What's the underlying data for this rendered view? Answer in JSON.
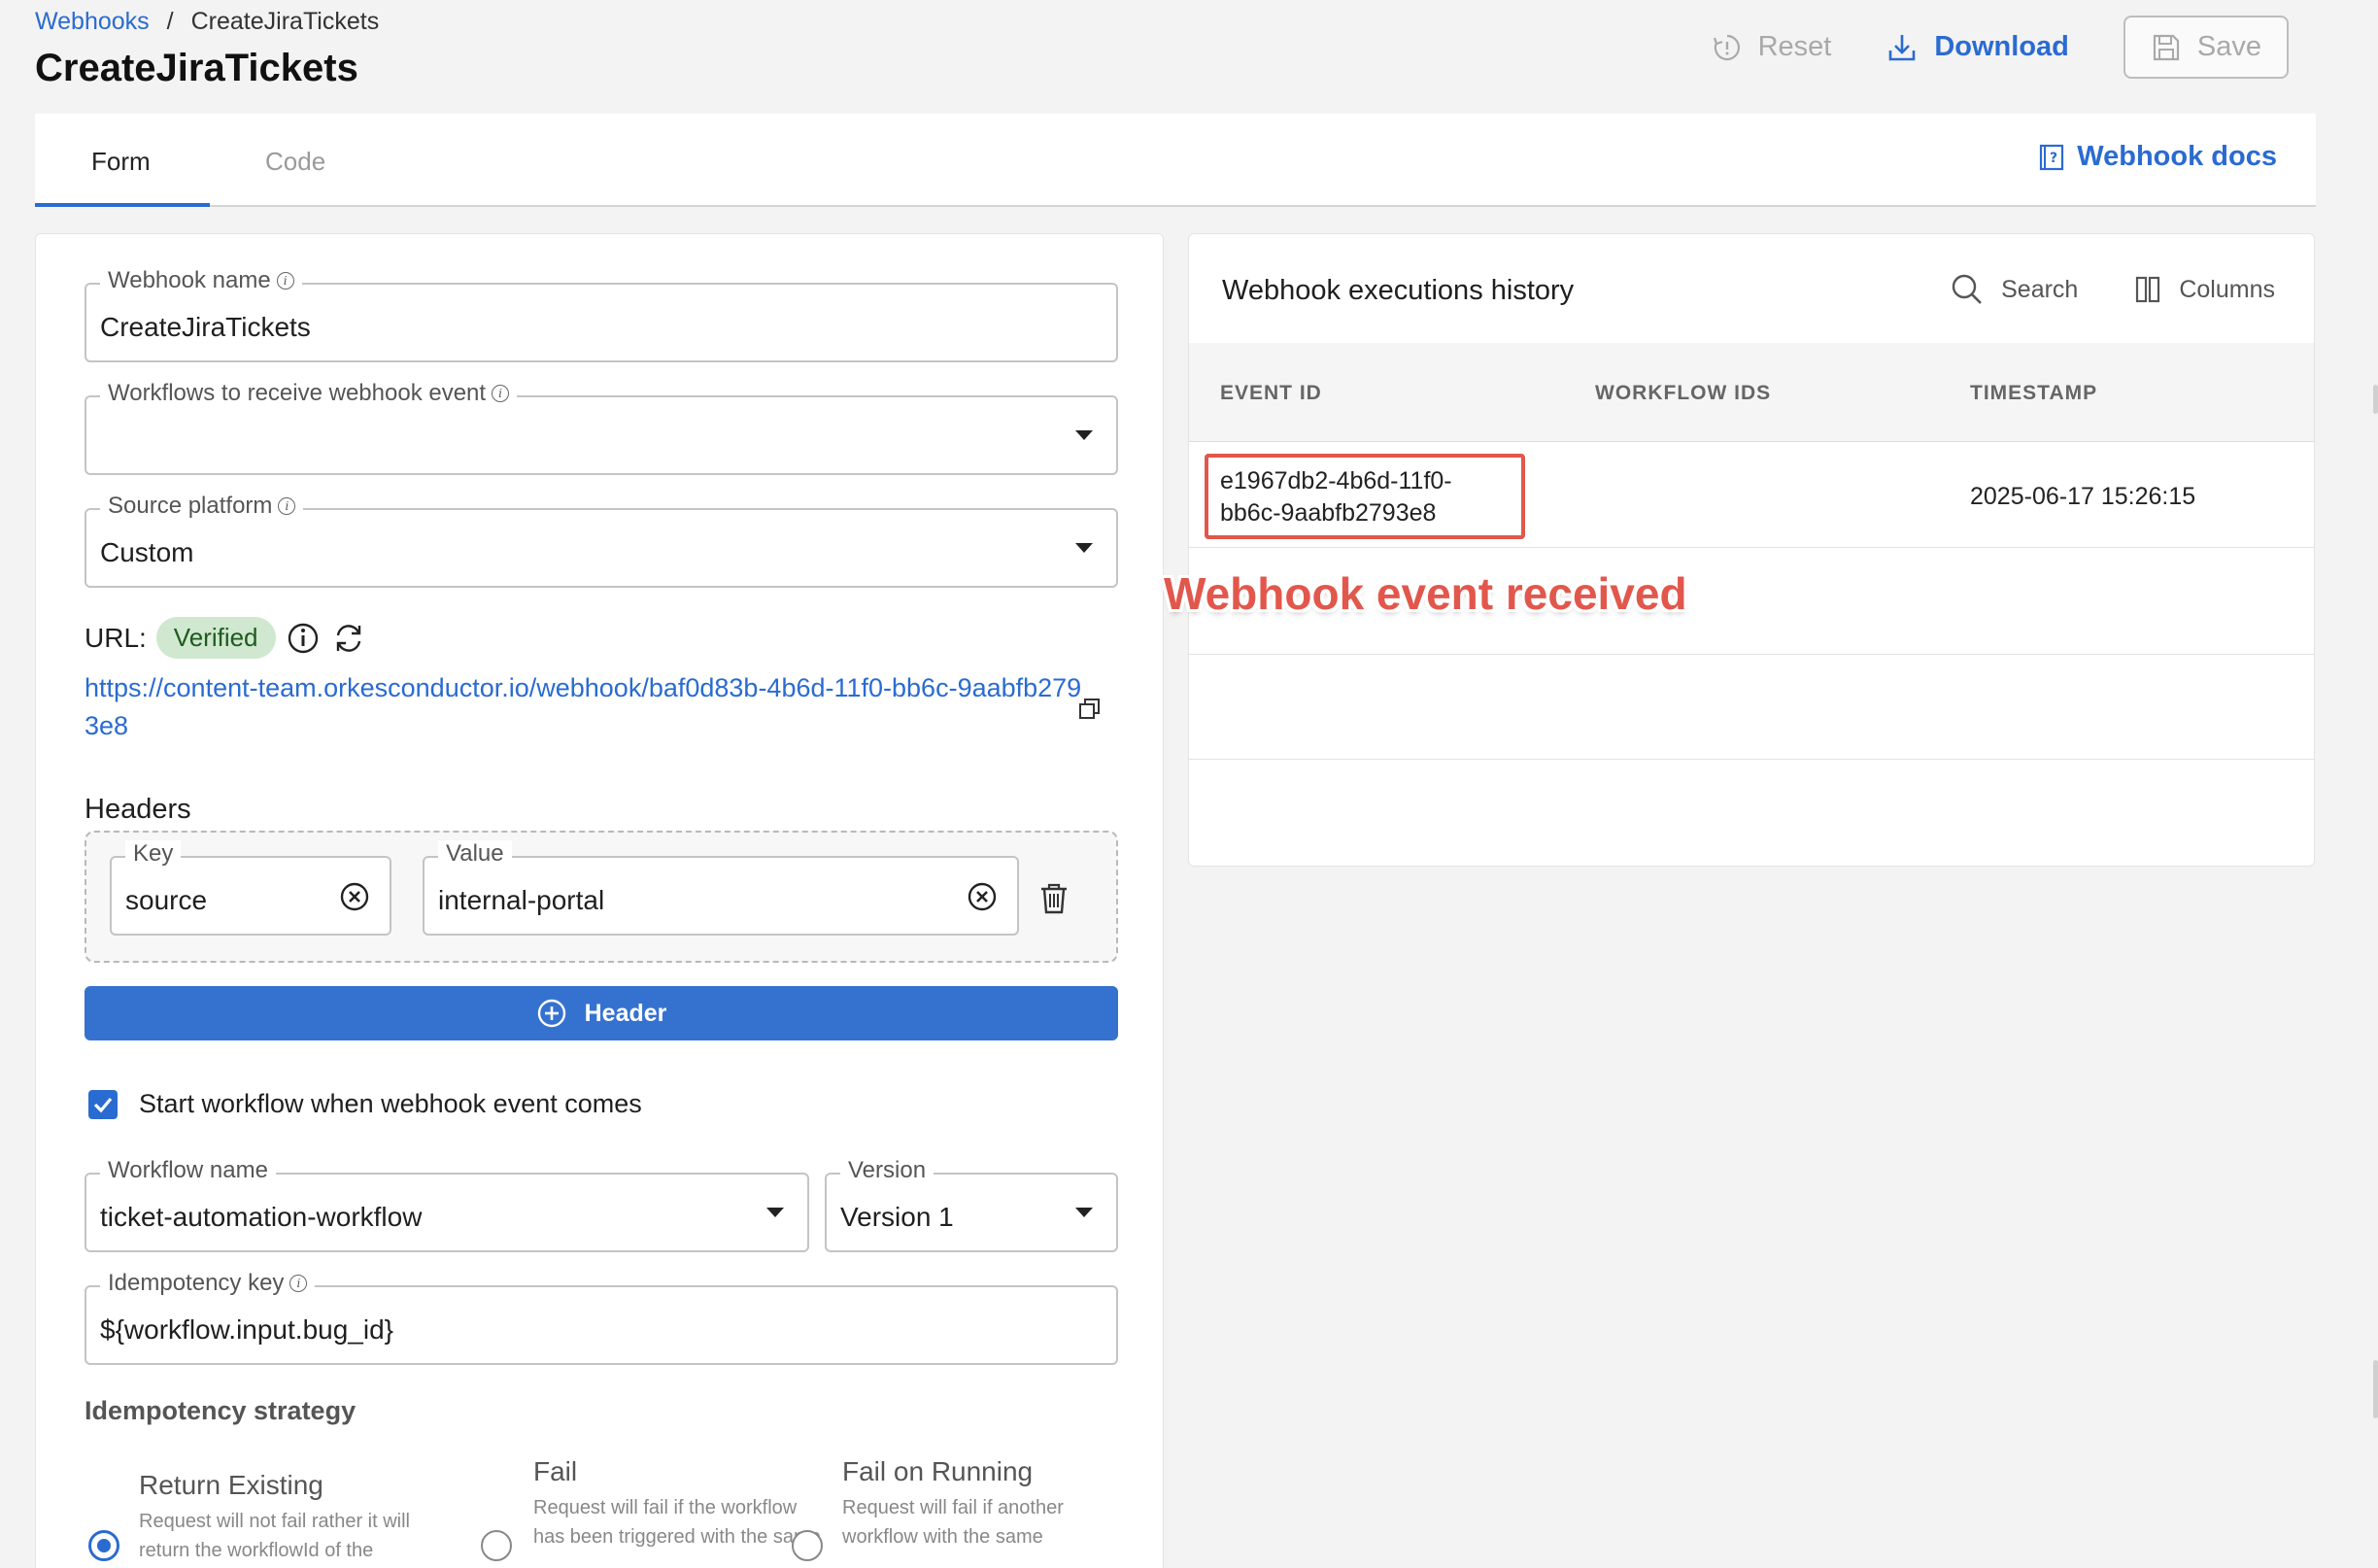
{
  "breadcrumb": {
    "parent": "Webhooks",
    "separator": "/",
    "current": "CreateJiraTickets"
  },
  "page_title": "CreateJiraTickets",
  "actions": {
    "reset": "Reset",
    "download": "Download",
    "save": "Save"
  },
  "tabs": [
    {
      "label": "Form"
    },
    {
      "label": "Code"
    }
  ],
  "docs_link": "Webhook docs",
  "form": {
    "webhook_name": {
      "label": "Webhook name",
      "value": "CreateJiraTickets"
    },
    "workflows": {
      "label": "Workflows to receive webhook event",
      "value": ""
    },
    "source_platform": {
      "label": "Source platform",
      "value": "Custom"
    },
    "url": {
      "label": "URL:",
      "status": "Verified",
      "value": "https://content-team.orkesconductor.io/webhook/baf0d83b-4b6d-11f0-bb6c-9aabfb2793e8"
    },
    "headers": {
      "title": "Headers",
      "key_label": "Key",
      "key_value": "source",
      "value_label": "Value",
      "value_value": "internal-portal",
      "add_button": "Header"
    },
    "start_workflow": {
      "label": "Start workflow when webhook event comes",
      "checked": true
    },
    "workflow_name": {
      "label": "Workflow name",
      "value": "ticket-automation-workflow"
    },
    "version": {
      "label": "Version",
      "value": "Version 1"
    },
    "idempotency_key": {
      "label": "Idempotency key",
      "value": "${workflow.input.bug_id}"
    },
    "idempotency_strategy": {
      "title": "Idempotency strategy",
      "options": [
        {
          "title": "Return Existing",
          "desc": "Request will not fail rather it will return the workflowId of the",
          "selected": true
        },
        {
          "title": "Fail",
          "desc": "Request will fail if the workflow has been triggered with the same",
          "selected": false
        },
        {
          "title": "Fail on Running",
          "desc": "Request will fail if another workflow with the same",
          "selected": false
        }
      ]
    }
  },
  "history": {
    "title": "Webhook executions history",
    "search": "Search",
    "columns": "Columns",
    "headers": [
      "EVENT ID",
      "WORKFLOW IDS",
      "TIMESTAMP"
    ],
    "rows": [
      {
        "event_id": "e1967db2-4b6d-11f0-bb6c-9aabfb2793e8",
        "workflow_ids": "",
        "timestamp": "2025-06-17 15:26:15"
      }
    ]
  },
  "annotation": "Webhook event received",
  "colors": {
    "accent": "#2a6bd1",
    "annotation": "#e2574c",
    "verified_bg": "#cfe8cf"
  }
}
